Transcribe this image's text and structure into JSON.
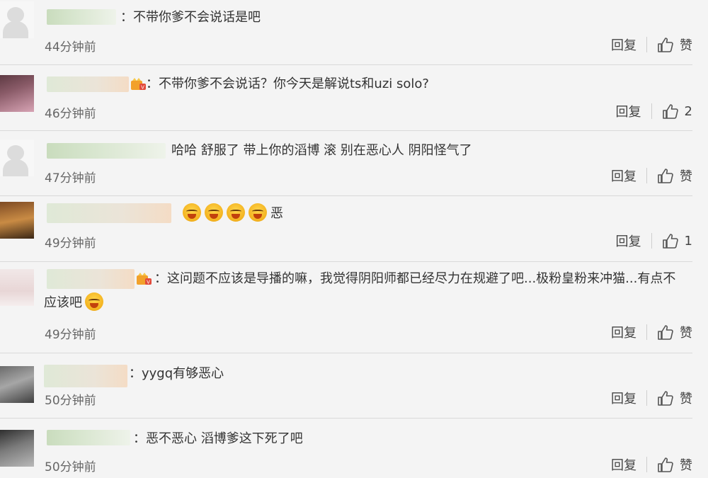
{
  "comments": [
    {
      "text": "：不带你爹不会说话是吧",
      "time": "44分钟前",
      "reply": "回复",
      "like": "赞"
    },
    {
      "text": "：不带你爹不会说话？你今天是解说ts和uzi solo?",
      "time": "46分钟前",
      "reply": "回复",
      "like": "2"
    },
    {
      "text": "哈哈 舒服了 带上你的滔博 滚 别在恶心人 阴阳怪气了",
      "time": "47分钟前",
      "reply": "回复",
      "like": "赞"
    },
    {
      "text": "恶",
      "time": "49分钟前",
      "reply": "回复",
      "like": "1"
    },
    {
      "text": "：这问题不应该是导播的嘛，我觉得阴阳师都已经尽力在规避了吧...极粉皇粉来冲猫...有点不应该吧",
      "time": "49分钟前",
      "reply": "回复",
      "like": "赞"
    },
    {
      "text": "：yygq有够恶心",
      "time": "50分钟前",
      "reply": "回复",
      "like": "赞"
    },
    {
      "text": "：恶不恶心 滔博爹这下死了吧",
      "time": "50分钟前",
      "reply": "回复",
      "like": "赞"
    }
  ]
}
